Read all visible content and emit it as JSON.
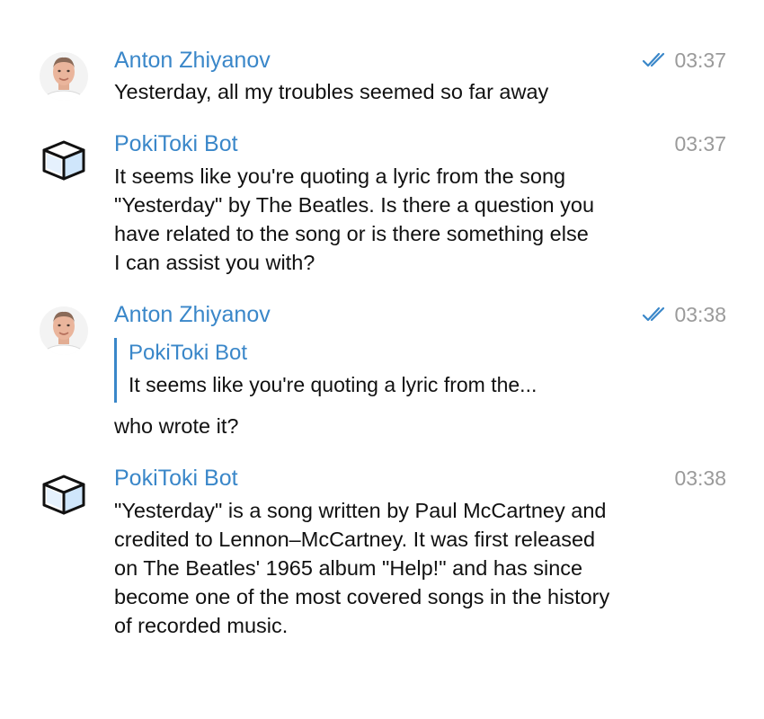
{
  "messages": [
    {
      "author": "Anton Zhiyanov",
      "time": "03:37",
      "status_icon": "double-check-icon",
      "avatar": "person-avatar",
      "text": "Yesterday, all my troubles seemed so far away"
    },
    {
      "author": "PokiToki Bot",
      "time": "03:37",
      "avatar": "cube-icon",
      "text": "It seems like you're quoting a lyric from the song \"Yesterday\" by The Beatles. Is there a question you have related to the song or is there something else I can assist you with?"
    },
    {
      "author": "Anton Zhiyanov",
      "time": "03:38",
      "status_icon": "double-check-icon",
      "avatar": "person-avatar",
      "reply": {
        "author": "PokiToki Bot",
        "text": "It seems like you're quoting a lyric from the..."
      },
      "text": "who wrote it?"
    },
    {
      "author": "PokiToki Bot",
      "time": "03:38",
      "avatar": "cube-icon",
      "text": "\"Yesterday\" is a song written by Paul McCartney and credited to Lennon–McCartney. It was first released on The Beatles' 1965 album \"Help!\" and has since become one of the most covered songs in the history of recorded music."
    }
  ],
  "colors": {
    "accent": "#3a87c9",
    "time": "#9a9a9a",
    "text": "#111111",
    "cube_fill": "#cfe6fb"
  }
}
